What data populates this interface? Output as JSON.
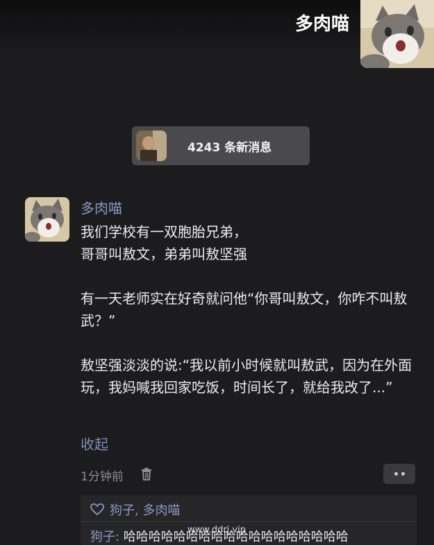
{
  "header": {
    "title": "多肉喵"
  },
  "new_messages": {
    "label": "4243 条新消息"
  },
  "post": {
    "author": "多肉喵",
    "paragraphs": [
      "我们学校有一双胞胎兄弟，\n哥哥叫敖文，弟弟叫敖坚强",
      "有一天老师实在好奇就问他“你哥叫敖文，你咋不叫敖武？”",
      "敖坚强淡淡的说:“我以前小时候就叫敖武，因为在外面玩，我妈喊我回家吃饭，时间长了，就给我改了...”"
    ],
    "collapse_label": "收起",
    "time": "1分钟前"
  },
  "likes": {
    "names": "狗子, 多肉喵"
  },
  "comment": {
    "author": "狗子:",
    "text": " 哈哈哈哈哈哈哈哈哈哈哈哈哈哈哈哈哈哈"
  },
  "watermark": "www.ddrj.vip"
}
